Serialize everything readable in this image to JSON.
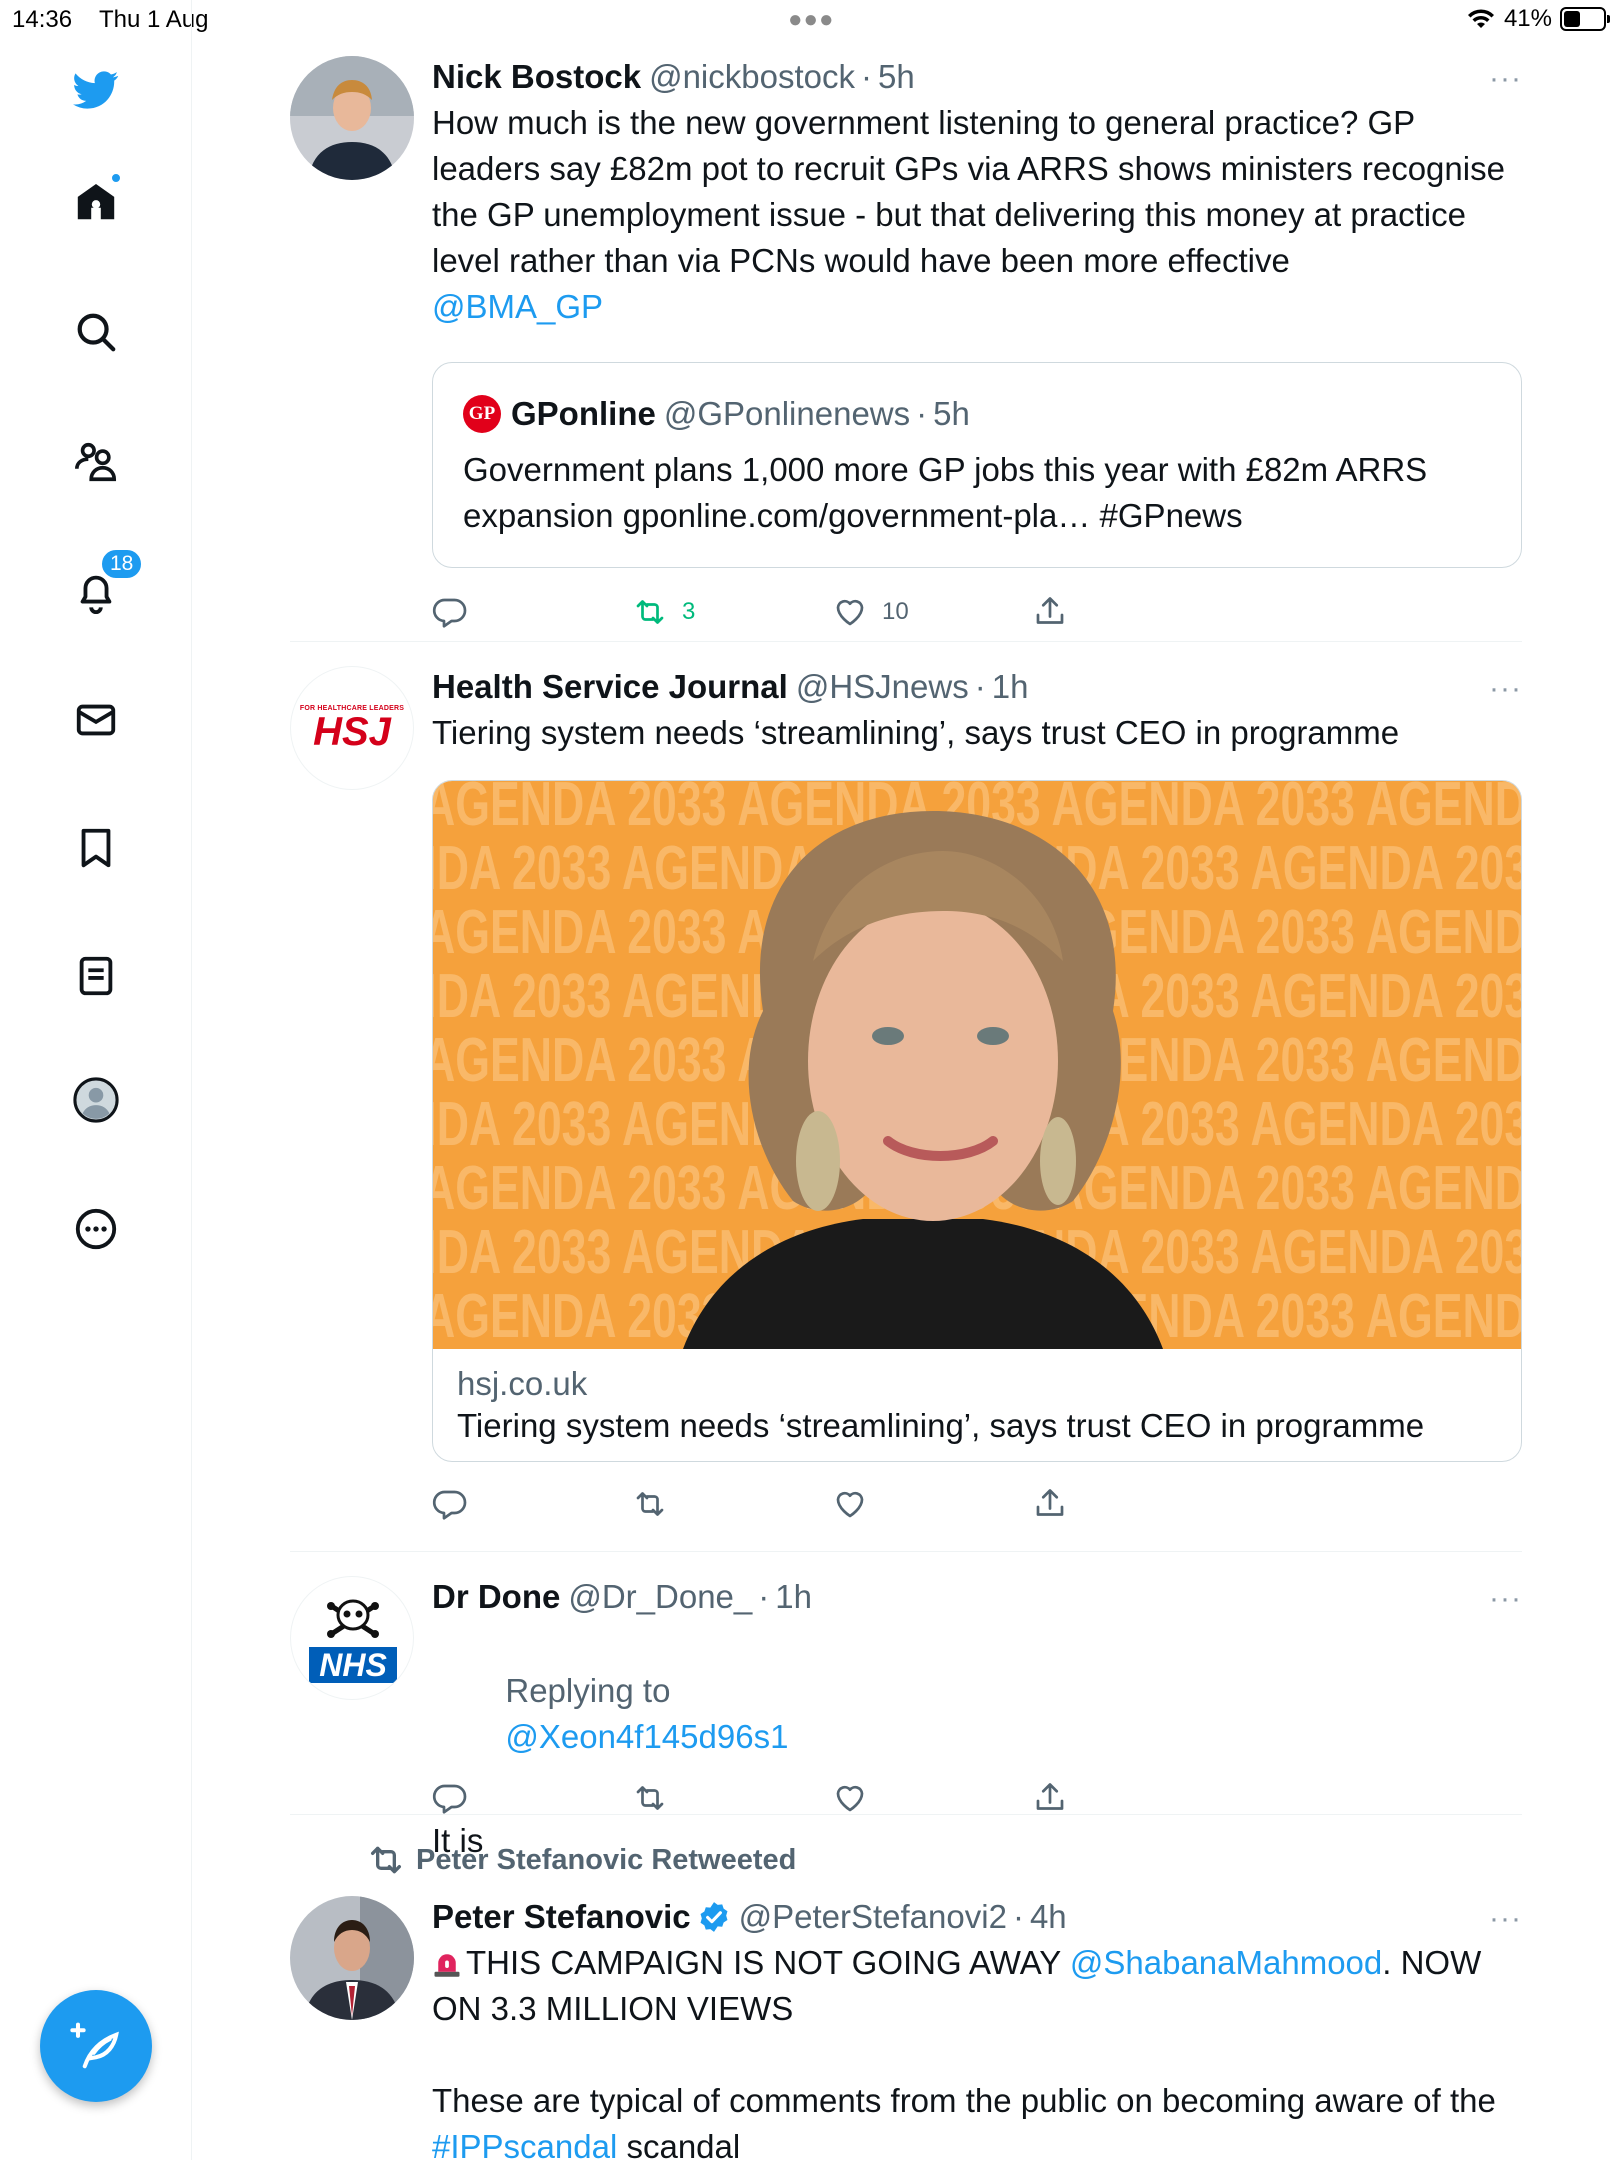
{
  "status_bar": {
    "time": "14:36",
    "date": "Thu 1 Aug",
    "battery": "41%",
    "battery_level": 0.41
  },
  "sidebar": {
    "items": [
      {
        "name": "home",
        "icon": "home-icon"
      },
      {
        "name": "explore",
        "icon": "search-icon"
      },
      {
        "name": "communities",
        "icon": "people-icon"
      },
      {
        "name": "notifications",
        "icon": "bell-icon",
        "badge": "18"
      },
      {
        "name": "messages",
        "icon": "mail-icon"
      },
      {
        "name": "bookmarks",
        "icon": "bookmark-icon"
      },
      {
        "name": "lists",
        "icon": "list-icon"
      },
      {
        "name": "profile",
        "icon": "profile-icon"
      },
      {
        "name": "more",
        "icon": "more-circle-icon"
      }
    ],
    "compose_icon": "compose-icon",
    "accent": "#1d9bf0"
  },
  "tweets": [
    {
      "name": "Nick Bostock",
      "handle": "@nickbostock",
      "sep": "·",
      "time": "5h",
      "more": "···",
      "text": "How much is the new government listening to general practice? GP leaders say £82m pot to recruit GPs via ARRS shows ministers recognise the GP unemployment issue - but that delivering this money at practice level rather than via PCNs would have been more effective",
      "mention": "@BMA_GP",
      "quote": {
        "logo": "GP",
        "name": "GPonline",
        "handle": "@GPonlinenews",
        "sep": "·",
        "time": "5h",
        "text": "Government plans 1,000 more GP jobs this year with £82m ARRS expansion gponline.com/government-pla… #GPnews"
      },
      "retweets": "3",
      "likes": "10"
    },
    {
      "name": "Health Service Journal",
      "handle": "@HSJnews",
      "sep": "·",
      "time": "1h",
      "more": "···",
      "avatar_small": "FOR HEALTHCARE LEADERS",
      "avatar_logo": "HSJ",
      "text": "Tiering system needs ‘streamlining’, says trust CEO in programme",
      "card": {
        "bg_text": "AGENDA 2033",
        "domain": "hsj.co.uk",
        "title": "Tiering system needs ‘streamlining’, says trust CEO in programme"
      }
    },
    {
      "name": "Dr Done",
      "handle": "@Dr_Done_",
      "sep": "·",
      "time": "1h",
      "more": "···",
      "avatar_logo": "NHS",
      "replying_to_label": "Replying to",
      "replying_to": "@Xeon4f145d96s1",
      "text": "It is"
    },
    {
      "retweeted_by": "Peter Stefanovic Retweeted",
      "name": "Peter Stefanovic",
      "handle": "@PeterStefanovi2",
      "sep": "·",
      "time": "4h",
      "more": "···",
      "text_pre": "THIS CAMPAIGN IS NOT GOING AWAY",
      "mention": "@ShabanaMahmood",
      "text_post": ". NOW ON 3.3 MILLION VIEWS",
      "text2_pre": "These are typical of comments from the public on becoming aware of the",
      "hashtag": "#IPPscandal",
      "text2_post": "scandal"
    }
  ]
}
